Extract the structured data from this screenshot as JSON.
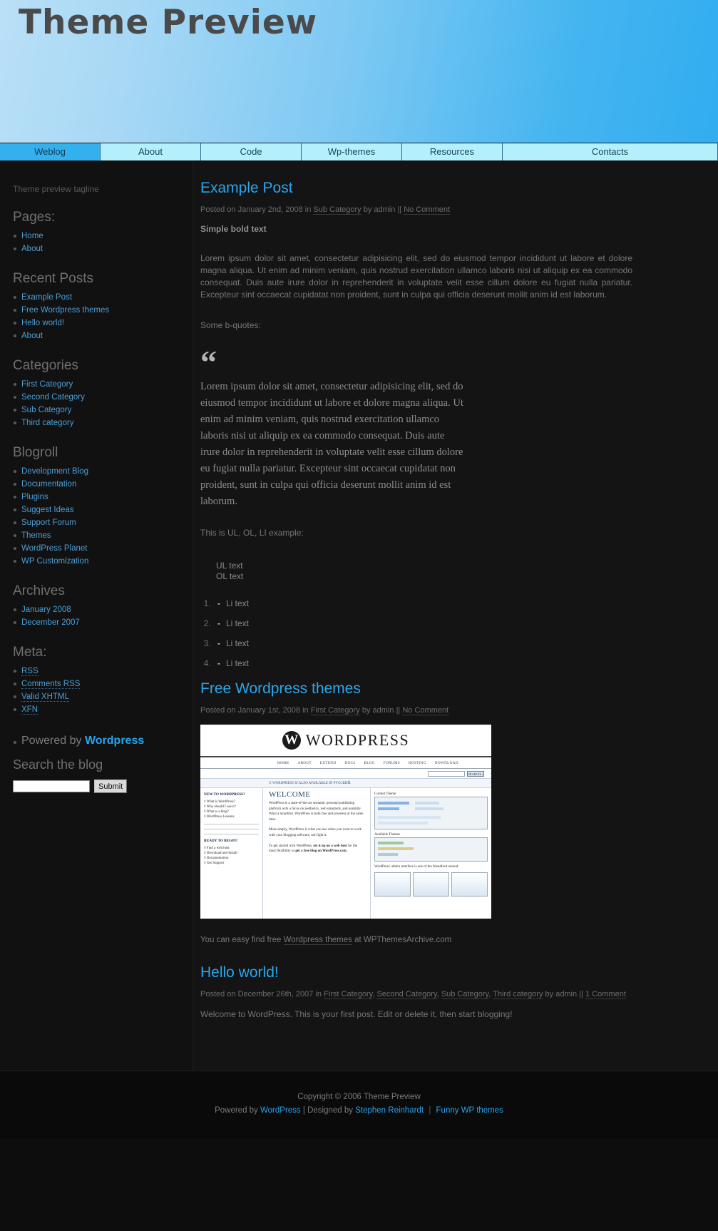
{
  "header": {
    "title": "Theme Preview"
  },
  "nav": {
    "items": [
      {
        "label": "Weblog",
        "current": true
      },
      {
        "label": "About",
        "current": false
      },
      {
        "label": "Code",
        "current": false
      },
      {
        "label": "Wp-themes",
        "current": false
      },
      {
        "label": "Resources",
        "current": false
      },
      {
        "label": "Contacts",
        "current": false
      }
    ]
  },
  "sidebar": {
    "tagline": "Theme preview tagline",
    "sections": [
      {
        "heading": "Pages:",
        "items": [
          {
            "label": "Home",
            "dotted": false
          },
          {
            "label": "About",
            "dotted": false
          }
        ]
      },
      {
        "heading": "Recent Posts",
        "items": [
          {
            "label": "Example Post",
            "dotted": false
          },
          {
            "label": "Free Wordpress themes",
            "dotted": false
          },
          {
            "label": "Hello world!",
            "dotted": false
          },
          {
            "label": "About",
            "dotted": false
          }
        ]
      },
      {
        "heading": "Categories",
        "items": [
          {
            "label": "First Category",
            "dotted": false
          },
          {
            "label": "Second Category",
            "dotted": false
          },
          {
            "label": "Sub Category",
            "dotted": false
          },
          {
            "label": "Third category",
            "dotted": false
          }
        ]
      },
      {
        "heading": "Blogroll",
        "items": [
          {
            "label": "Development Blog",
            "dotted": false
          },
          {
            "label": "Documentation",
            "dotted": false
          },
          {
            "label": "Plugins",
            "dotted": false
          },
          {
            "label": "Suggest Ideas",
            "dotted": false
          },
          {
            "label": "Support Forum",
            "dotted": false
          },
          {
            "label": "Themes",
            "dotted": false
          },
          {
            "label": "WordPress Planet",
            "dotted": false
          },
          {
            "label": "WP Customization",
            "dotted": false
          }
        ]
      },
      {
        "heading": "Archives",
        "items": [
          {
            "label": "January 2008",
            "dotted": false
          },
          {
            "label": "December 2007",
            "dotted": false
          }
        ]
      },
      {
        "heading": "Meta:",
        "items": [
          {
            "label": "RSS",
            "dotted": true
          },
          {
            "label": "Comments RSS",
            "dotted": true
          },
          {
            "label": "Valid XHTML",
            "dotted": true
          },
          {
            "label": "XFN",
            "dotted": true
          }
        ]
      }
    ],
    "powered": {
      "prefix": "Powered by",
      "link": "Wordpress"
    },
    "search": {
      "heading": "Search the blog",
      "value": "",
      "placeholder": "",
      "submit_label": "Submit"
    }
  },
  "posts": [
    {
      "title": "Example Post",
      "meta": {
        "posted_on": "Posted on January 2nd, 2008 in",
        "category": "Sub Category",
        "by": "by admin",
        "separator": "||",
        "comments": "No Comment"
      },
      "bold_text": "Simple bold text",
      "paragraph": "Lorem ipsum dolor sit amet, consectetur adipisicing elit, sed do eiusmod tempor incididunt ut labore et dolore magna aliqua. Ut enim ad minim veniam, quis nostrud exercitation ullamco laboris nisi ut aliquip ex ea commodo consequat. Duis aute irure dolor in reprehenderit in voluptate velit esse cillum dolore eu fugiat nulla pariatur. Excepteur sint occaecat cupidatat non proident, sunt in culpa qui officia deserunt mollit anim id est laborum.",
      "bquote_intro": "Some b-quotes:",
      "bquote_mark": "“",
      "bquote_text": "Lorem ipsum dolor sit amet, consectetur adipisicing elit, sed do eiusmod tempor incididunt ut labore et dolore magna aliqua. Ut enim ad minim veniam, quis nostrud exercitation ullamco laboris nisi ut aliquip ex ea commodo consequat. Duis aute irure dolor in reprehenderit in voluptate velit esse cillum dolore eu fugiat nulla pariatur. Excepteur sint occaecat cupidatat non proident, sunt in culpa qui officia deserunt mollit anim id est laborum.",
      "list_intro": "This is UL, OL, LI example:",
      "ul_items": [
        "UL text",
        "OL text"
      ],
      "ol_items": [
        "Li text",
        "Li text",
        "Li text",
        "Li text"
      ],
      "ol_dash": "-"
    },
    {
      "title": "Free Wordpress themes",
      "meta": {
        "posted_on": "Posted on January 1st, 2008 in",
        "category": "First Category",
        "by": "by admin",
        "separator": "||",
        "comments": "No Comment"
      },
      "caption": {
        "before": "You can easy find free",
        "link": "Wordpress themes",
        "after": "at WPThemesArchive.com"
      }
    },
    {
      "title": "Hello world!",
      "meta": {
        "posted_on": "Posted on December 26th, 2007 in",
        "categories": [
          "First Category",
          "Second Category",
          "Sub Category",
          "Third category"
        ],
        "by": "by admin",
        "separator": "||",
        "comments": "1 Comment"
      },
      "body": "Welcome to WordPress. This is your first post. Edit or delete it, then start blogging!"
    }
  ],
  "wp_screenshot": {
    "logo_letter": "W",
    "logo_text": "WORDPRESS",
    "menu": [
      "HOME",
      "ABOUT",
      "EXTEND",
      "DOCS",
      "BLOG",
      "FORUMS",
      "HOSTING",
      "DOWNLOAD"
    ],
    "search_button": "SEARCH »",
    "notice": "© WORDPRESS IS ALSO AVAILABLE IN РУССКИЙ.",
    "left_col": {
      "title": "NEW TO WORDPRESS?",
      "links": [
        "◊ What is WordPress?",
        "◊ Why should I use it?",
        "◊ What is a blog?",
        "◊ WordPress Lessons"
      ],
      "ready_title": "READY TO BEGIN?",
      "ready_links": [
        "◊ Find a web host",
        "◊ Download and Install",
        "◊ Documentation",
        "◊ Get Support"
      ]
    },
    "mid_col": {
      "welcome": "WELCOME",
      "p1": "WordPress is a state-of-the-art semantic personal publishing platform with a focus on aesthetics, web standards, and usability. What a mouthful. WordPress is both free and priceless at the same time.",
      "p2": "More simply, WordPress is what you use when you want to work with your blogging software, not fight it.",
      "p3_before": "To get started with WordPress,",
      "p3_bold1": "set it up on a web host",
      "p3_mid": "for the most flexibility or",
      "p3_bold2": "get a free blog on WordPress.com."
    },
    "right_col": {
      "current_theme": "Current Theme",
      "avail_themes": "Available Themes",
      "caption": "WordPress' admin interface is one of the friendliest around."
    }
  },
  "footer": {
    "copyright": "Copyright © 2006 Theme Preview",
    "powered_prefix": "Powered by",
    "wordpress": "WordPress",
    "designed_prefix": "| Designed by",
    "designer": "Stephen Reinhardt",
    "sep": "|",
    "funny": "Funny WP themes"
  }
}
